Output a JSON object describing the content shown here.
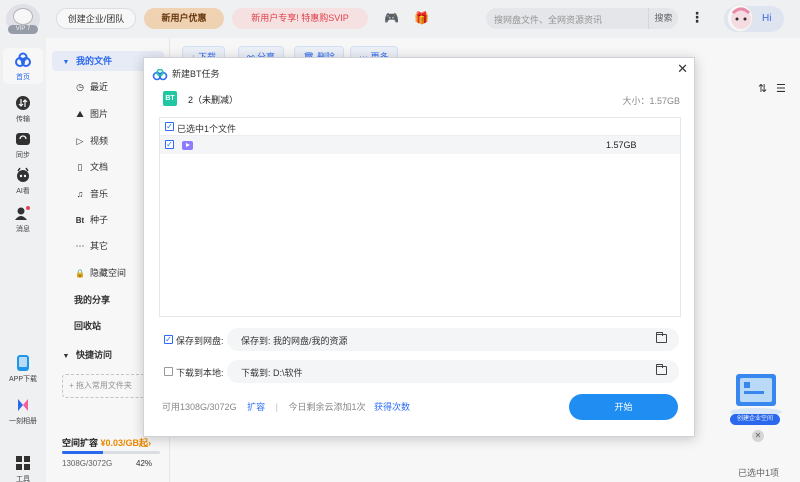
{
  "topbar": {
    "logo_badge": "VIP 7",
    "org_button": "创建企业/团队",
    "new_user_button": "新用户优惠",
    "svip_button": "新用户专享! 特惠购SVIP",
    "search_placeholder": "搜网盘文件、全网资源资讯",
    "search_button": "搜索",
    "greeting": "Hi"
  },
  "rail": {
    "items": [
      {
        "label": "首页",
        "icon": "home-icon"
      },
      {
        "label": "传输",
        "icon": "transfer-icon"
      },
      {
        "label": "同步",
        "icon": "sync-icon"
      },
      {
        "label": "AI看",
        "icon": "ai-icon"
      },
      {
        "label": "消息",
        "icon": "message-icon"
      },
      {
        "label": "APP下载",
        "icon": "app-download-icon"
      },
      {
        "label": "一刻相册",
        "icon": "album-icon"
      },
      {
        "label": "工具",
        "icon": "tools-icon"
      }
    ]
  },
  "sidebar": {
    "my_files": "我的文件",
    "items": [
      {
        "label": "最近",
        "icon": "clock-icon",
        "glyph": "◷"
      },
      {
        "label": "图片",
        "icon": "image-icon",
        "glyph": "⛰"
      },
      {
        "label": "视频",
        "icon": "video-icon",
        "glyph": "▷"
      },
      {
        "label": "文档",
        "icon": "document-icon",
        "glyph": "▯"
      },
      {
        "label": "音乐",
        "icon": "music-icon",
        "glyph": "♫"
      },
      {
        "label": "种子",
        "icon": "bt-icon",
        "glyph": "Bt"
      },
      {
        "label": "其它",
        "icon": "more-icon",
        "glyph": "⋯"
      },
      {
        "label": "隐藏空间",
        "icon": "lock-icon",
        "glyph": "🔒"
      }
    ],
    "my_share": "我的分享",
    "recycle": "回收站",
    "quick_access": "快捷访问",
    "drop_hint": "+ 拖入常用文件夹",
    "quota_label": "空间扩容",
    "quota_rate": "¥0.03/GB起",
    "quota_used": "1308G/3072G",
    "quota_percent": "42%",
    "quota_fraction": 0.42
  },
  "main": {
    "toolbar": [
      "下载",
      "分享",
      "删除",
      "更多"
    ],
    "status": "已选中1项",
    "promo_label": "创建企业空间"
  },
  "dialog": {
    "title": "新建BT任务",
    "bt_badge": "BT",
    "torrent_name": "2（未删减）",
    "total_size": "大小：1.57GB",
    "selected_label": "已选中1个文件",
    "files": [
      {
        "name": "",
        "size": "1.57GB",
        "checked": true
      }
    ],
    "save_to_cloud": {
      "label": "保存到网盘:",
      "prefix": "保存到:",
      "path": "我的网盘/我的资源",
      "checked": true
    },
    "save_to_local": {
      "label": "下载到本地:",
      "prefix": "下载到:",
      "path": "D:\\软件",
      "checked": false
    },
    "footer": {
      "available": "可用1308G/3072G",
      "expand": "扩容",
      "sep": "|",
      "remaining": "今日剩余云添加1次",
      "get_more": "获得次数"
    },
    "start_button": "开始"
  },
  "colors": {
    "accent": "#2c6cf6",
    "start_button": "#1f8df2",
    "bt_badge": "#1fc8a3",
    "svip_text": "#e8434d"
  }
}
